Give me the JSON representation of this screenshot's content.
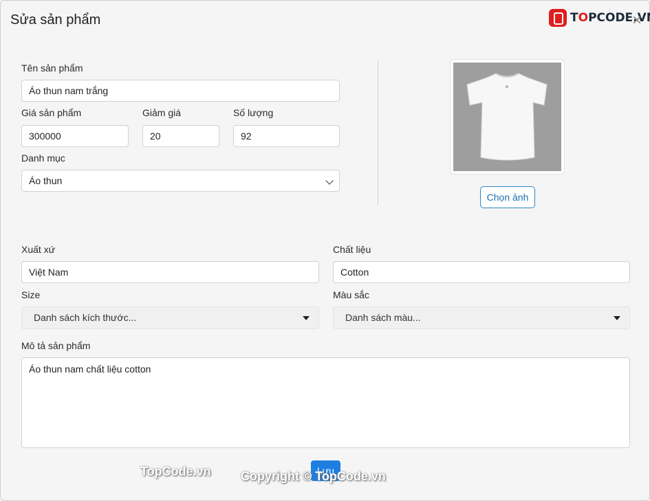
{
  "dialog": {
    "title": "Sửa sản phẩm",
    "close_icon": "×"
  },
  "brand": {
    "text_pre": "T",
    "text_o": "O",
    "text_post": "PCODE.VN"
  },
  "form": {
    "name_label": "Tên sản phẩm",
    "name_value": "Áo thun nam trắng",
    "price_label": "Giá sản phẩm",
    "price_value": "300000",
    "discount_label": "Giảm giá",
    "discount_value": "20",
    "quantity_label": "Số lượng",
    "quantity_value": "92",
    "category_label": "Danh mục",
    "category_value": "Áo thun",
    "origin_label": "Xuất xứ",
    "origin_value": "Việt Nam",
    "material_label": "Chất liệu",
    "material_value": "Cotton",
    "size_label": "Size",
    "size_placeholder": "Danh sách kích thước...",
    "color_label": "Màu sắc",
    "color_placeholder": "Danh sách màu...",
    "description_label": "Mô tả sản phẩm",
    "description_value": "Áo thun nam chất liệu cotton"
  },
  "image": {
    "choose_label": "Chọn ảnh",
    "icon": "tshirt-image"
  },
  "actions": {
    "save_label": "Lưu"
  },
  "watermarks": {
    "left": "TopCode.vn",
    "center": "Copyright © TopCode.vn"
  }
}
